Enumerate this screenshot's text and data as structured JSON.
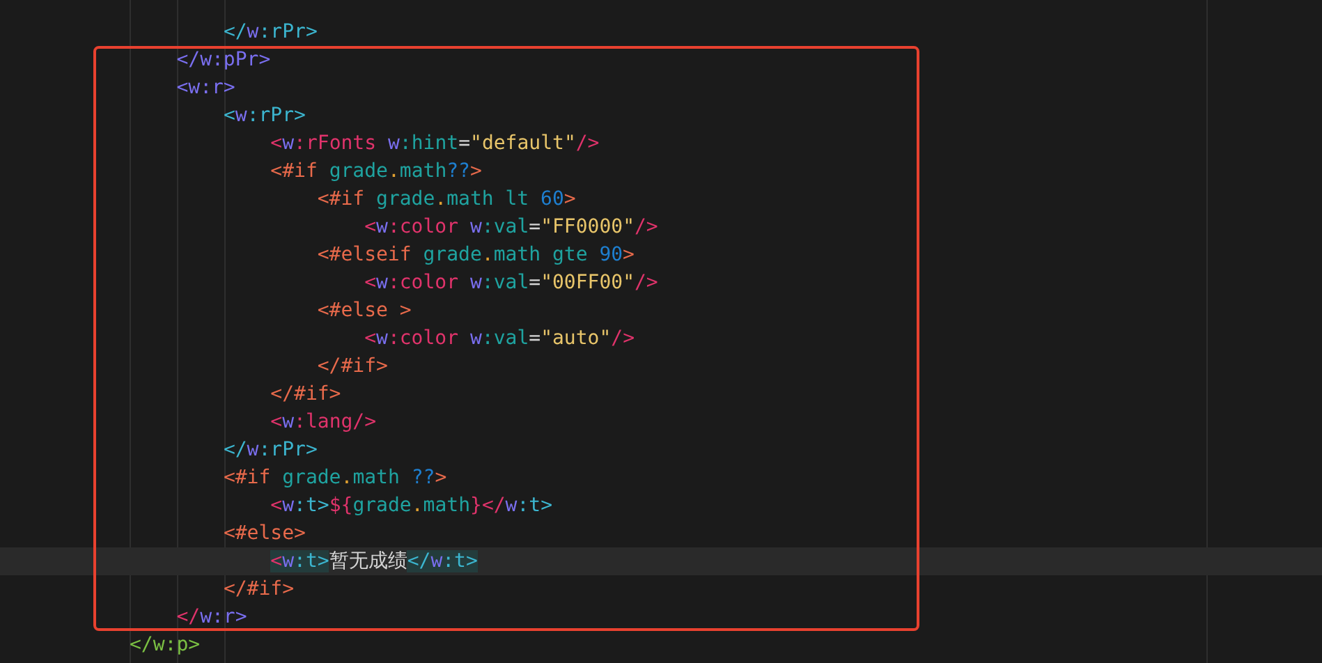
{
  "editor": {
    "lines": [
      {
        "current": false,
        "tokens": [
          {
            "text": "        </",
            "color": "#3cb6d0"
          },
          {
            "text": "w",
            "color": "#7a6ff0"
          },
          {
            "text": ":rPr>",
            "color": "#3cb6d0"
          }
        ]
      },
      {
        "current": false,
        "tokens": [
          {
            "text": "    </w:pPr>",
            "color": "#7a6ff0"
          }
        ]
      },
      {
        "current": false,
        "tokens": [
          {
            "text": "    <w:r>",
            "color": "#7a6ff0"
          }
        ]
      },
      {
        "current": false,
        "tokens": [
          {
            "text": "        <",
            "color": "#3cb6d0"
          },
          {
            "text": "w",
            "color": "#7a6ff0"
          },
          {
            "text": ":rPr>",
            "color": "#3cb6d0"
          }
        ]
      },
      {
        "current": false,
        "tokens": [
          {
            "text": "            <",
            "color": "#e0336b"
          },
          {
            "text": "w",
            "color": "#7a6ff0"
          },
          {
            "text": ":rFonts",
            "color": "#e0336b"
          },
          {
            "text": " w",
            "color": "#7a6ff0"
          },
          {
            "text": ":hint",
            "color": "#1fa3a0"
          },
          {
            "text": "=",
            "color": "#d4d4d4"
          },
          {
            "text": "\"default\"",
            "color": "#e8c56a"
          },
          {
            "text": "/>",
            "color": "#e0336b"
          }
        ]
      },
      {
        "current": false,
        "tokens": [
          {
            "text": "            <#if",
            "color": "#e86a4b"
          },
          {
            "text": " grade",
            "color": "#1fa3a0"
          },
          {
            "text": ".",
            "color": "#e0a030"
          },
          {
            "text": "math",
            "color": "#1fa3a0"
          },
          {
            "text": "??",
            "color": "#1e7fd0"
          },
          {
            "text": ">",
            "color": "#e86a4b"
          }
        ]
      },
      {
        "current": false,
        "tokens": [
          {
            "text": "                <#if",
            "color": "#e86a4b"
          },
          {
            "text": " grade",
            "color": "#1fa3a0"
          },
          {
            "text": ".",
            "color": "#e0a030"
          },
          {
            "text": "math lt ",
            "color": "#1fa3a0"
          },
          {
            "text": "60",
            "color": "#1e7fd0"
          },
          {
            "text": ">",
            "color": "#e86a4b"
          }
        ]
      },
      {
        "current": false,
        "tokens": [
          {
            "text": "                    <",
            "color": "#e0336b"
          },
          {
            "text": "w",
            "color": "#7a6ff0"
          },
          {
            "text": ":color",
            "color": "#e0336b"
          },
          {
            "text": " w",
            "color": "#7a6ff0"
          },
          {
            "text": ":val",
            "color": "#1fa3a0"
          },
          {
            "text": "=",
            "color": "#d4d4d4"
          },
          {
            "text": "\"FF0000\"",
            "color": "#e8c56a"
          },
          {
            "text": "/>",
            "color": "#e0336b"
          }
        ]
      },
      {
        "current": false,
        "tokens": [
          {
            "text": "                <#elseif",
            "color": "#e86a4b"
          },
          {
            "text": " grade",
            "color": "#1fa3a0"
          },
          {
            "text": ".",
            "color": "#e0a030"
          },
          {
            "text": "math gte ",
            "color": "#1fa3a0"
          },
          {
            "text": "90",
            "color": "#1e7fd0"
          },
          {
            "text": ">",
            "color": "#e86a4b"
          }
        ]
      },
      {
        "current": false,
        "tokens": [
          {
            "text": "                    <",
            "color": "#e0336b"
          },
          {
            "text": "w",
            "color": "#7a6ff0"
          },
          {
            "text": ":color",
            "color": "#e0336b"
          },
          {
            "text": " w",
            "color": "#7a6ff0"
          },
          {
            "text": ":val",
            "color": "#1fa3a0"
          },
          {
            "text": "=",
            "color": "#d4d4d4"
          },
          {
            "text": "\"00FF00\"",
            "color": "#e8c56a"
          },
          {
            "text": "/>",
            "color": "#e0336b"
          }
        ]
      },
      {
        "current": false,
        "tokens": [
          {
            "text": "                <#else >",
            "color": "#e86a4b"
          }
        ]
      },
      {
        "current": false,
        "tokens": [
          {
            "text": "                    <",
            "color": "#e0336b"
          },
          {
            "text": "w",
            "color": "#7a6ff0"
          },
          {
            "text": ":color",
            "color": "#e0336b"
          },
          {
            "text": " w",
            "color": "#7a6ff0"
          },
          {
            "text": ":val",
            "color": "#1fa3a0"
          },
          {
            "text": "=",
            "color": "#d4d4d4"
          },
          {
            "text": "\"auto\"",
            "color": "#e8c56a"
          },
          {
            "text": "/>",
            "color": "#e0336b"
          }
        ]
      },
      {
        "current": false,
        "tokens": [
          {
            "text": "                </#if>",
            "color": "#e86a4b"
          }
        ]
      },
      {
        "current": false,
        "tokens": [
          {
            "text": "            </#if>",
            "color": "#e86a4b"
          }
        ]
      },
      {
        "current": false,
        "tokens": [
          {
            "text": "            <",
            "color": "#e0336b"
          },
          {
            "text": "w",
            "color": "#7a6ff0"
          },
          {
            "text": ":lang/>",
            "color": "#e0336b"
          }
        ]
      },
      {
        "current": false,
        "tokens": [
          {
            "text": "        </",
            "color": "#3cb6d0"
          },
          {
            "text": "w",
            "color": "#7a6ff0"
          },
          {
            "text": ":rPr>",
            "color": "#3cb6d0"
          }
        ]
      },
      {
        "current": false,
        "tokens": [
          {
            "text": "        <#if",
            "color": "#e86a4b"
          },
          {
            "text": " grade",
            "color": "#1fa3a0"
          },
          {
            "text": ".",
            "color": "#e0a030"
          },
          {
            "text": "math ",
            "color": "#1fa3a0"
          },
          {
            "text": "??",
            "color": "#1e7fd0"
          },
          {
            "text": ">",
            "color": "#e86a4b"
          }
        ]
      },
      {
        "current": false,
        "tokens": [
          {
            "text": "            <",
            "color": "#e0336b"
          },
          {
            "text": "w",
            "color": "#7a6ff0"
          },
          {
            "text": ":t>",
            "color": "#3cb6d0"
          },
          {
            "text": "${",
            "color": "#e0336b"
          },
          {
            "text": "grade",
            "color": "#1fa3a0"
          },
          {
            "text": ".",
            "color": "#e0a030"
          },
          {
            "text": "math",
            "color": "#1fa3a0"
          },
          {
            "text": "}",
            "color": "#e0336b"
          },
          {
            "text": "</",
            "color": "#e0336b"
          },
          {
            "text": "w",
            "color": "#7a6ff0"
          },
          {
            "text": ":t>",
            "color": "#3cb6d0"
          }
        ]
      },
      {
        "current": false,
        "tokens": [
          {
            "text": "        <#else>",
            "color": "#e86a4b"
          }
        ]
      },
      {
        "current": true,
        "tokens": [
          {
            "text": "            <",
            "color": "#e0336b",
            "highlighted": true
          },
          {
            "text": "w",
            "color": "#7a6ff0",
            "highlighted": true
          },
          {
            "text": ":t>",
            "color": "#3cb6d0",
            "highlighted": true
          },
          {
            "text": "暂无成绩",
            "color": "#d4d4d4",
            "highlighted": false
          },
          {
            "text": "</",
            "color": "#3cb6d0",
            "highlighted": true
          },
          {
            "text": "w",
            "color": "#7a6ff0",
            "highlighted": true
          },
          {
            "text": ":t>",
            "color": "#3cb6d0",
            "highlighted": true
          }
        ]
      },
      {
        "current": false,
        "tokens": [
          {
            "text": "        </#if>",
            "color": "#e86a4b"
          }
        ]
      },
      {
        "current": false,
        "tokens": [
          {
            "text": "    </",
            "color": "#e0336b"
          },
          {
            "text": "w:r>",
            "color": "#7a6ff0"
          }
        ]
      },
      {
        "current": false,
        "tokens": [
          {
            "text": "</w:p>",
            "color": "#7bc043"
          }
        ]
      }
    ]
  }
}
